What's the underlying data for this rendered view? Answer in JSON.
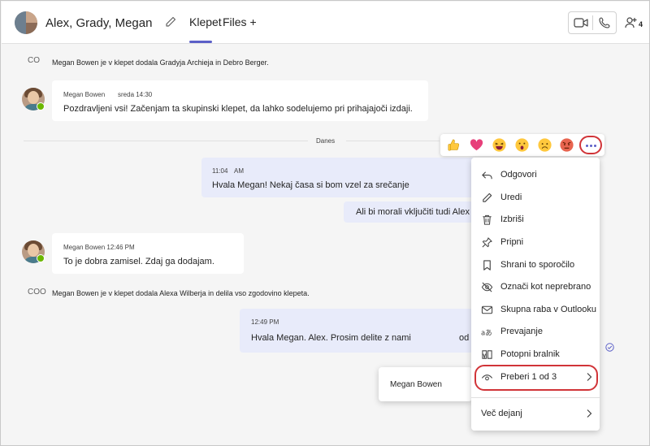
{
  "header": {
    "chat_title": "Alex, Grady, Megan",
    "tab_chat": "Klepet",
    "tab_files": "Files +",
    "participant_count": "4"
  },
  "messages": {
    "system1_icon": "CO",
    "system1": "Megan Bowen je v klepet dodala Gradyja Archieja in Debro Berger.",
    "msg1_sender": "Megan Bowen",
    "msg1_time": "sreda 14:30",
    "msg1_text": "Pozdravljeni vsi! Začenjam ta skupinski klepet, da lahko sodelujemo pri prihajajoči izdaji.",
    "date_divider": "Danes",
    "msg2_time": "11:04",
    "msg2_time_suffix": "AM",
    "msg2_text": "Hvala Megan! Nekaj časa si bom vzel za srečanje",
    "msg3_text": "Ali bi morali vključiti tudi Alex",
    "msg4_sender": "Megan Bowen 12:46 PM",
    "msg4_text": "To je dobra zamisel. Zdaj ga dodajam.",
    "system2_icon": "COO",
    "system2": "Megan Bowen je v klepet dodala Alexa Wilberja in delila vso zgodovino klepeta.",
    "msg5_time": "12:49 PM",
    "msg5_text": "Hvala Megan. Alex. Prosim delite z nami",
    "msg5_overflow": "od"
  },
  "reactions": [
    "like-icon",
    "heart-icon",
    "laugh-icon",
    "surprised-icon",
    "sad-icon",
    "angry-icon"
  ],
  "menu": {
    "items": [
      {
        "label": "Odgovori",
        "icon": "reply-icon"
      },
      {
        "label": "Uredi",
        "icon": "edit-icon"
      },
      {
        "label": "Izbriši",
        "icon": "delete-icon"
      },
      {
        "label": "Pripni",
        "icon": "pin-icon"
      },
      {
        "label": "Shrani to sporočilo",
        "icon": "bookmark-icon"
      },
      {
        "label": "Označi kot neprebrano",
        "icon": "unread-icon"
      },
      {
        "label": "Skupna raba v Outlooku",
        "icon": "mail-icon"
      },
      {
        "label": "Prevajanje",
        "icon": "translate-icon"
      },
      {
        "label": "Potopni bralnik",
        "icon": "reader-icon"
      },
      {
        "label": "Preberi 1 od 3",
        "icon": "eye-icon"
      }
    ],
    "more_actions": "Več dejanj"
  },
  "readby": {
    "name": "Megan Bowen"
  },
  "colors": {
    "accent": "#5b5fc7",
    "highlight": "#d13438",
    "presence": "#6bb700",
    "outgoing_bubble": "#e8ebfa"
  }
}
